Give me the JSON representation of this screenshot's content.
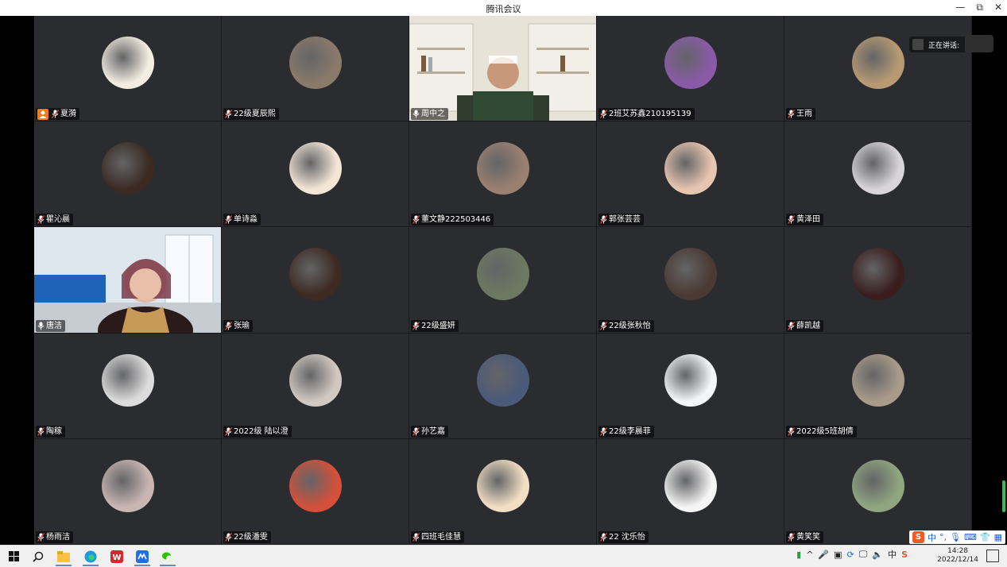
{
  "window": {
    "title": "腾讯会议",
    "minimize_icon": "minimize-icon",
    "restore_icon": "restore-icon",
    "close_icon": "close-icon"
  },
  "speaking_indicator": {
    "label": "正在讲话:"
  },
  "participants": [
    {
      "name": "夏漪",
      "host": true,
      "muted": true,
      "avatar": "#f4ede1"
    },
    {
      "name": "22级夏辰熙",
      "muted": true,
      "avatar": "#8a7a6a"
    },
    {
      "name": "周中之",
      "muted": false,
      "video": "bookshelf"
    },
    {
      "name": "2班艾苏鑫210195139",
      "muted": true,
      "avatar": "#8a5aa8"
    },
    {
      "name": "王雨",
      "muted": true,
      "avatar": "#b79a73"
    },
    {
      "name": "瞿沁晨",
      "muted": true,
      "avatar": "#3a2a22"
    },
    {
      "name": "单诗淼",
      "muted": true,
      "avatar": "#f3e6d6"
    },
    {
      "name": "董文静222503446",
      "muted": true,
      "avatar": "#9a8070"
    },
    {
      "name": "郭张芸芸",
      "muted": true,
      "avatar": "#e8c5b0"
    },
    {
      "name": "黄泽田",
      "muted": true,
      "avatar": "#d7d5d8"
    },
    {
      "name": "唐洁",
      "muted": false,
      "video": "room"
    },
    {
      "name": "张瑜",
      "muted": true,
      "avatar": "#3d2a22"
    },
    {
      "name": "22级盛妍",
      "muted": true,
      "avatar": "#6d7860"
    },
    {
      "name": "22级张秋怡",
      "muted": true,
      "avatar": "#4a3a33"
    },
    {
      "name": "薛凯越",
      "muted": true,
      "avatar": "#3a1e1e"
    },
    {
      "name": "陶稼",
      "muted": true,
      "avatar": "#dcdcdc"
    },
    {
      "name": "2022级 陆以澄",
      "muted": true,
      "avatar": "#d2c8c2"
    },
    {
      "name": "孙艺嘉",
      "muted": true,
      "avatar": "#4a5a7a"
    },
    {
      "name": "22级李晨菲",
      "muted": true,
      "avatar": "#f4f6f7"
    },
    {
      "name": "2022级5班胡倩",
      "muted": true,
      "avatar": "#a99b8a"
    },
    {
      "name": "杨雨洁",
      "muted": true,
      "avatar": "#c9b6b3"
    },
    {
      "name": "22级潘雯",
      "muted": true,
      "avatar": "#d4503a"
    },
    {
      "name": "四班毛佳慧",
      "muted": true,
      "avatar": "#f1dec3"
    },
    {
      "name": "22 沈乐怡",
      "muted": true,
      "avatar": "#f5f5f5"
    },
    {
      "name": "黄笑笑",
      "muted": true,
      "avatar": "#8fa680"
    }
  ],
  "ime": {
    "logo": "S",
    "lang": "中",
    "punct": "°,",
    "mic": "mic-icon",
    "keyboard": "keyboard-icon",
    "skin": "shirt-icon",
    "apps": "grid-icon"
  },
  "taskbar": {
    "start_icon": "windows-start-icon",
    "search_icon": "search-icon",
    "apps": [
      {
        "name": "file-explorer-icon",
        "active": true
      },
      {
        "name": "edge-browser-icon",
        "active": true
      },
      {
        "name": "wps-office-icon",
        "active": false
      },
      {
        "name": "tencent-meeting-icon",
        "active": true
      },
      {
        "name": "wechat-icon",
        "active": true
      }
    ],
    "tray_lang": "中",
    "time": "14:28",
    "date": "2022/12/14"
  },
  "colors": {
    "tile_bg": "#2b2c2f",
    "host_badge": "#f27a1a",
    "taskbar_bg": "#f0f0f0",
    "sogou_orange": "#f05a28"
  }
}
